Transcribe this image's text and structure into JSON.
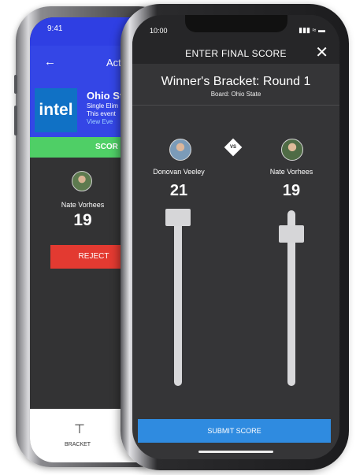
{
  "back_app": {
    "status_time": "9:41",
    "nav_title": "Act",
    "event": {
      "logo_text": "intel",
      "title": "Ohio St",
      "sub_line1": "Single Elim",
      "sub_line2": "This event",
      "link": "View Eve"
    },
    "score_banner": "SCOR",
    "player": {
      "name": "Nate Vorhees",
      "score": "19"
    },
    "reject_label": "REJECT",
    "tab_label": "BRACKET"
  },
  "front_app": {
    "status_time": "10:00",
    "modal_title": "ENTER FINAL SCORE",
    "round_title": "Winner's Bracket: Round 1",
    "board": "Board: Ohio State",
    "vs_label": "VS",
    "player_left": {
      "name": "Donovan Veeley",
      "score": "21"
    },
    "player_right": {
      "name": "Nate Vorhees",
      "score": "19"
    },
    "submit_label": "SUBMIT SCORE"
  },
  "colors": {
    "back_nav": "#3446e6",
    "score_banner": "#4fcf66",
    "reject": "#e33a31",
    "submit": "#2f8be0"
  },
  "icons": [
    "back-arrow-icon",
    "bracket-icon",
    "close-icon",
    "signal-icon",
    "wifi-icon",
    "battery-icon"
  ]
}
